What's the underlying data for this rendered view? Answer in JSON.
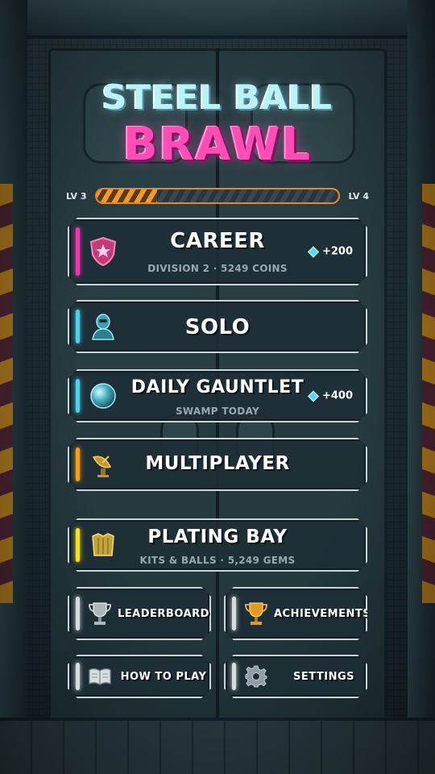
{
  "title": {
    "line1": "STEEL BALL",
    "line2": "BRAWL"
  },
  "level": {
    "current_label": "LV 3",
    "next_label": "LV 4",
    "progress": 0.25
  },
  "colors": {
    "career_accent": "#e83aa8",
    "solo_accent": "#4fd0e6",
    "gauntlet_accent": "#4fd0e6",
    "multiplayer_accent": "#f0a020",
    "plating_accent": "#f2e030",
    "neutral_accent": "#d6dde0",
    "progress_fill": "#f39a2a",
    "title_pink": "#ff4db8",
    "title_cyan": "#b8f4f7"
  },
  "menu": {
    "career": {
      "label": "CAREER",
      "sub": "DIVISION 2 · 5249 COINS",
      "reward": "+200",
      "icon": "shield-star-icon"
    },
    "solo": {
      "label": "SOLO",
      "icon": "robot-bust-icon"
    },
    "daily": {
      "label": "DAILY GAUNTLET",
      "sub": "SWAMP TODAY",
      "reward": "+400",
      "icon": "steel-ball-icon"
    },
    "multiplayer": {
      "label": "MULTIPLAYER",
      "icon": "satellite-dish-icon"
    },
    "plating": {
      "label": "PLATING BAY",
      "sub": "KITS & BALLS · 5,249 GEMS",
      "icon": "armor-plate-icon"
    },
    "leaderboards": {
      "label": "LEADERBOARDS",
      "icon": "silver-trophy-icon"
    },
    "achievements": {
      "label": "ACHIEVEMENTS",
      "icon": "gold-trophy-icon"
    },
    "howto": {
      "label": "HOW TO PLAY",
      "icon": "book-icon"
    },
    "settings": {
      "label": "SETTINGS",
      "icon": "gear-icon"
    }
  }
}
